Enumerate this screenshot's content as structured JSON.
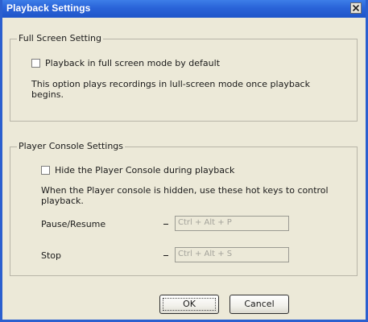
{
  "window": {
    "title": "Playback Settings"
  },
  "full_screen": {
    "legend": "Full Screen Setting",
    "checkbox_label": "Playback in full screen mode by default",
    "description_line1": "This option plays recordings in lull-screen mode once playback",
    "description_line2": "begins."
  },
  "console": {
    "legend": "Player Console Settings",
    "checkbox_label": "Hide the Player Console during playback",
    "description_line1": "When the Player console is hidden, use these hot keys to control",
    "description_line2": "playback.",
    "pause_label": "Pause/Resume",
    "pause_hotkey": "Ctrl + Alt + P",
    "stop_label": "Stop",
    "stop_hotkey": "Ctrl + Alt + S"
  },
  "buttons": {
    "ok_label": "OK",
    "cancel_label": "Cancel"
  }
}
